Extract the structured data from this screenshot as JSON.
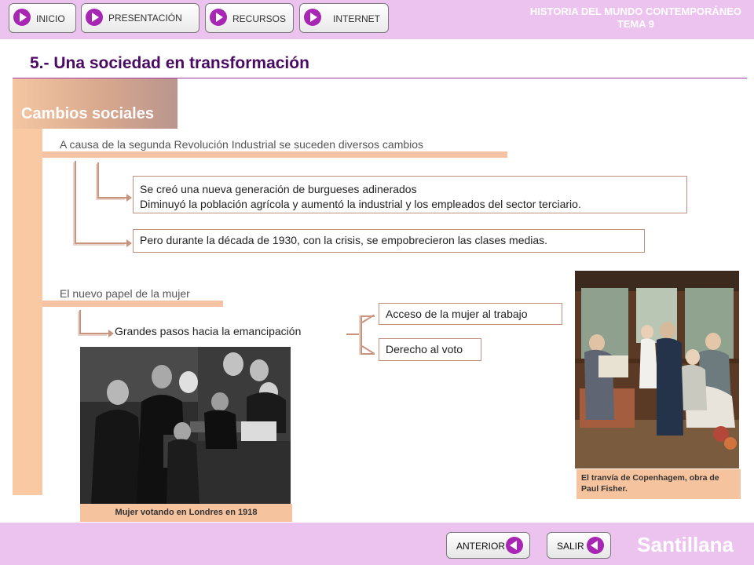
{
  "nav": {
    "buttons": [
      {
        "label": "INICIO"
      },
      {
        "label": "PRESENTACIÓN"
      },
      {
        "label": "RECURSOS"
      },
      {
        "label": "INTERNET"
      }
    ],
    "course_title": "HISTORIA DEL MUNDO CONTEMPORÁNEO",
    "unit": "TEMA 9"
  },
  "page_title": "5.- Una sociedad en transformación",
  "section": {
    "label": "Cambios sociales",
    "topic1": {
      "heading": "A causa de la segunda Revolución Industrial se suceden diversos cambios",
      "box1_line1": "Se creó una nueva generación de burgueses adinerados",
      "box1_line2": "Diminuyó la población agrícola y aumentó la industrial y los empleados del sector terciario.",
      "box2": "Pero durante la década de 1930, con la crisis, se empobrecieron las clases medias."
    },
    "topic2": {
      "heading": "El nuevo papel de la mujer",
      "step": "Grandes pasos hacia la emancipación",
      "items": [
        "Acceso de la mujer al trabajo",
        "Derecho al voto"
      ]
    }
  },
  "photos": {
    "london_caption": "Mujer votando en Londres en 1918",
    "tram_caption_line1": "El tranvía de Copenhagem, obra de",
    "tram_caption_line2": "Paul Fisher."
  },
  "footer": {
    "prev_label": "ANTERIOR",
    "exit_label": "SALIR",
    "brand": "Santillana"
  },
  "colors": {
    "header_bg": "#ecc3ef",
    "accent_purple": "#a726b4",
    "title_color": "#4b0a63",
    "peach": "#f8c9a2"
  }
}
